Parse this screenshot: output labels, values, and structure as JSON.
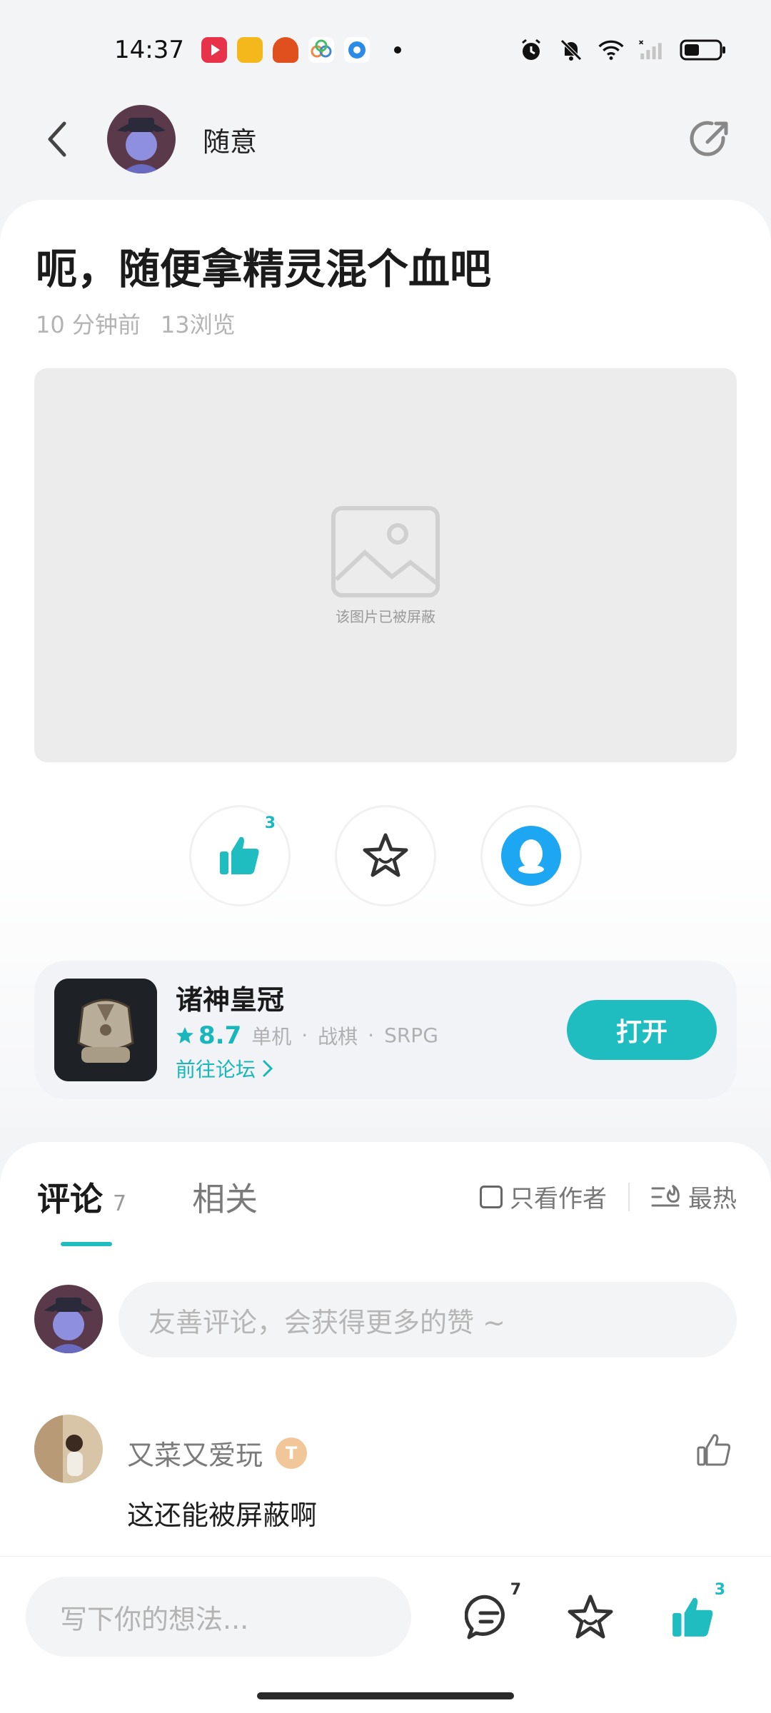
{
  "status_bar": {
    "time": "14:37",
    "app_icons": [
      "video-app-icon",
      "reader-app-icon",
      "taptap-app-icon",
      "photos-app-icon",
      "chrome-app-icon",
      "dot-icon"
    ],
    "right_icons": [
      "alarm-icon",
      "mute-icon",
      "wifi-icon",
      "signal-icon",
      "battery-icon"
    ]
  },
  "header": {
    "author_name": "随意"
  },
  "post": {
    "title": "呃，随便拿精灵混个血吧",
    "time_ago": "10 分钟前",
    "views": "13浏览",
    "blocked_image_text": "该图片已被屏蔽",
    "like_count": "3"
  },
  "game": {
    "name": "诸神皇冠",
    "score": "8.7",
    "tag1": "单机",
    "tag2": "战棋",
    "tag3": "SRPG",
    "forum_link": "前往论坛",
    "open_label": "打开",
    "accent": "#1fbcc0"
  },
  "comments": {
    "tab_comments": "评论",
    "count": "7",
    "tab_related": "相关",
    "only_author": "只看作者",
    "sort_label": "最热",
    "input_placeholder": "友善评论，会获得更多的赞 ~",
    "items": [
      {
        "user": "又菜又爱玩",
        "badge": "T",
        "text": "这还能被屏蔽啊"
      }
    ]
  },
  "bottom_bar": {
    "input_placeholder": "写下你的想法...",
    "comment_count": "7",
    "like_count": "3"
  }
}
